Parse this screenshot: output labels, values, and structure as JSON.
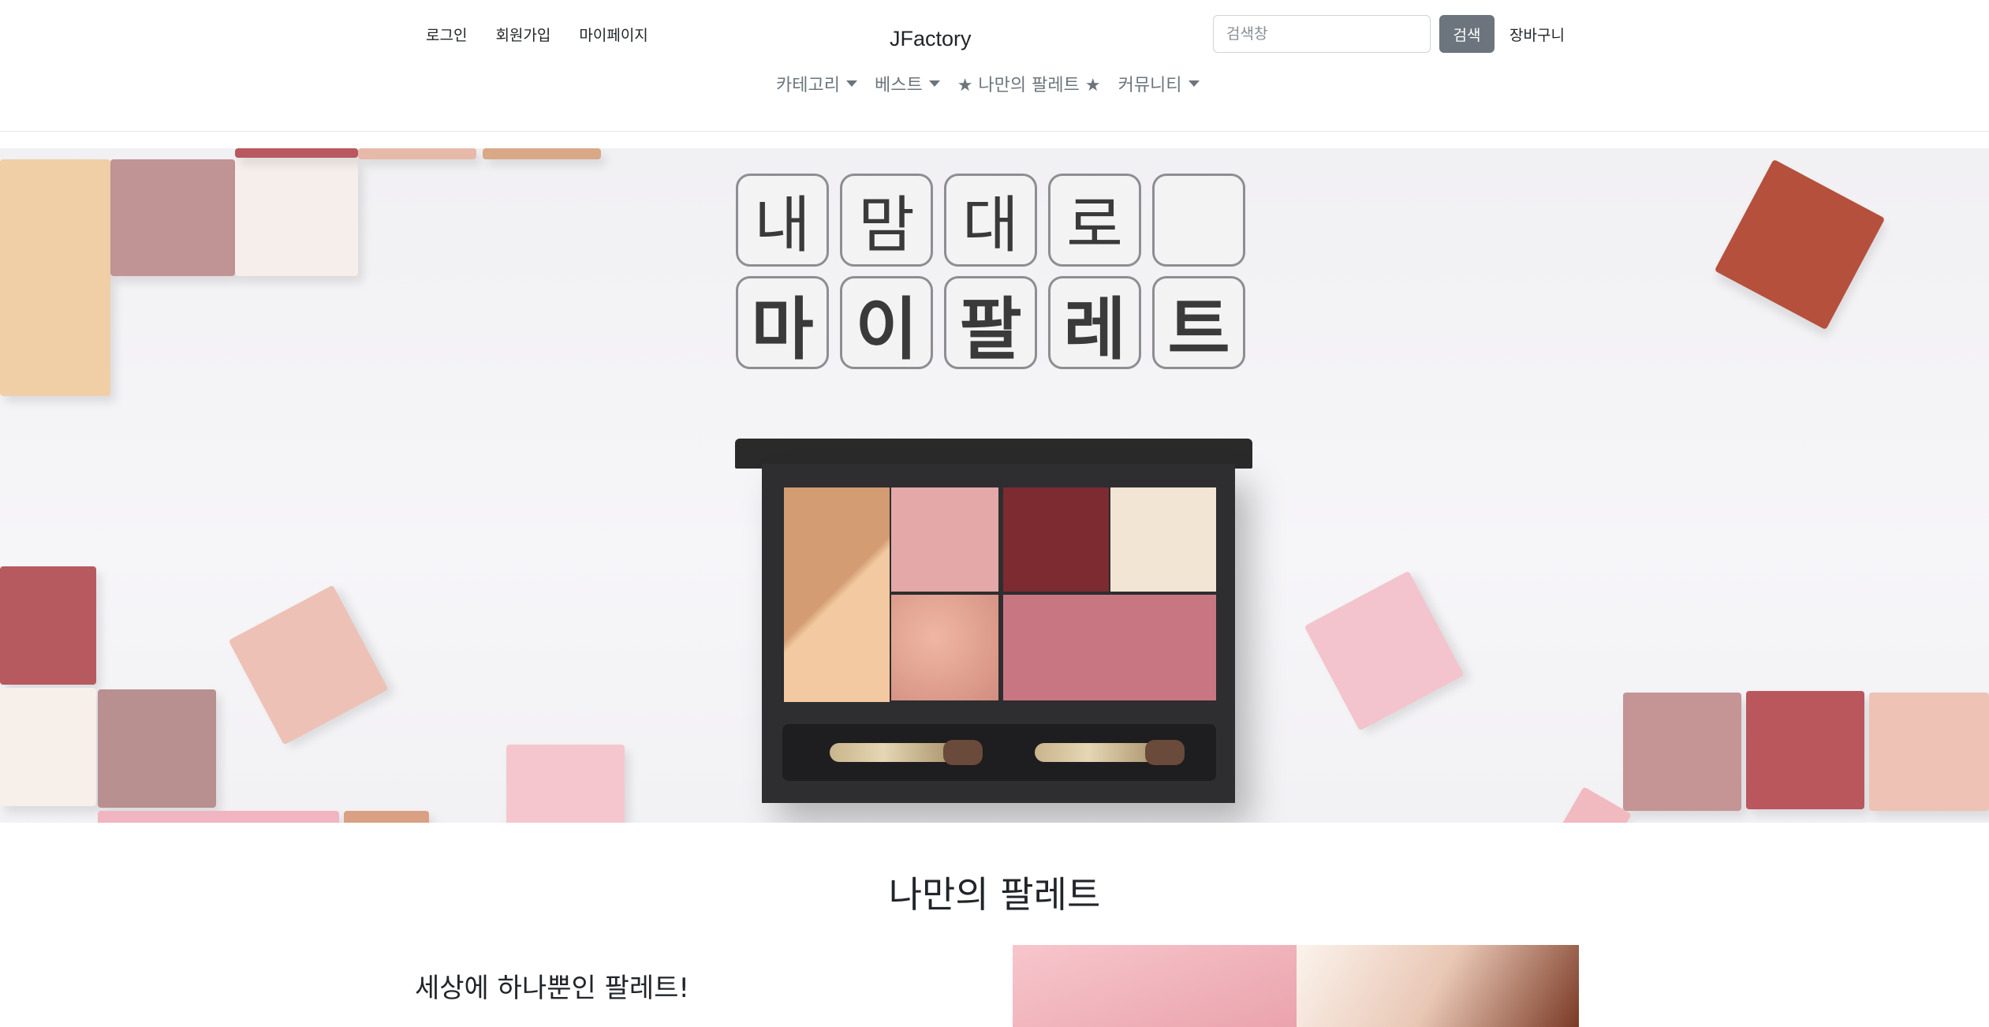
{
  "header": {
    "links": {
      "login": "로그인",
      "signup": "회원가입",
      "mypage": "마이페이지"
    },
    "brand": "JFactory",
    "search": {
      "placeholder": "검색창",
      "value": "",
      "button": "검색"
    },
    "cart": "장바구니"
  },
  "nav": {
    "category": "카테고리",
    "best": "베스트",
    "my_palette": "★ 나만의 팔레트 ★",
    "community": "커뮤니티"
  },
  "hero": {
    "tiles_row1": [
      "내",
      "맘",
      "대",
      "로",
      ""
    ],
    "tiles_row2": [
      "마",
      "이",
      "팔",
      "레",
      "트"
    ]
  },
  "section": {
    "title": "나만의 팔레트",
    "tagline": "세상에 하나뿐인 팔레트!"
  },
  "colors": {
    "search_button": "#6c757d",
    "nav_text": "#6c757d",
    "palette_case": "#2e2d2f"
  }
}
